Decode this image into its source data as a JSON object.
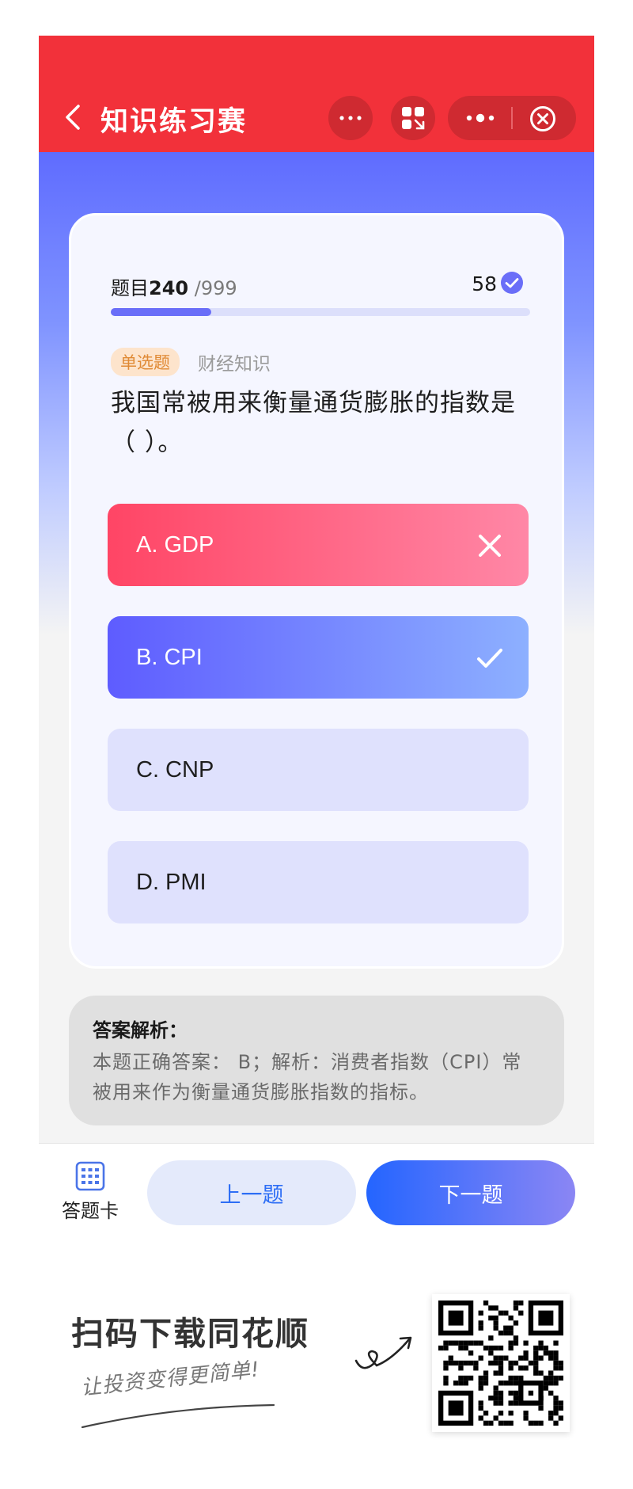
{
  "header": {
    "title": "知识练习赛",
    "background": "#f2313a"
  },
  "quiz": {
    "progress_label": "题目",
    "current": "240",
    "total_text": "/999",
    "progress_fraction": 0.24,
    "score": "58",
    "type_tag": "单选题",
    "category": "财经知识",
    "question": "我国常被用来衡量通货膨胀的指数是（ ）。",
    "options": [
      {
        "label": "A. GDP",
        "state": "wrong"
      },
      {
        "label": "B. CPI",
        "state": "correct"
      },
      {
        "label": "C. CNP",
        "state": "none"
      },
      {
        "label": "D. PMI",
        "state": "none"
      }
    ]
  },
  "analysis": {
    "title": "答案解析：",
    "text": "本题正确答案： B；解析：消费者指数（CPI）常被用来作为衡量通货膨胀指数的指标。"
  },
  "footer": {
    "answer_card": "答题卡",
    "prev": "上一题",
    "next": "下一题"
  },
  "promo": {
    "title": "扫码下载同花顺",
    "subtitle": "让投资变得更简单!"
  }
}
